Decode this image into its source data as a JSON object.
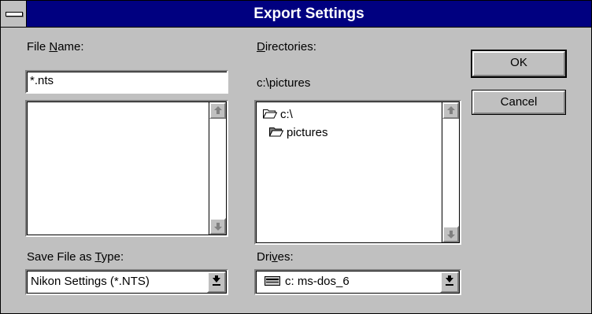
{
  "window": {
    "title": "Export Settings"
  },
  "file_name": {
    "label_pre": "File ",
    "label_accel": "N",
    "label_post": "ame:",
    "value": "*.nts",
    "files": []
  },
  "save_type": {
    "label_pre": "Save File as ",
    "label_accel": "T",
    "label_post": "ype:",
    "selected": "Nikon Settings (*.NTS)"
  },
  "directories": {
    "label_pre": "",
    "label_accel": "D",
    "label_post": "irectories:",
    "current_path": "c:\\pictures",
    "tree": [
      {
        "label": "c:\\",
        "icon": "open-folder-icon"
      },
      {
        "label": "pictures",
        "icon": "open-folder-icon"
      }
    ]
  },
  "drives": {
    "label_pre": "Dri",
    "label_accel": "v",
    "label_post": "es:",
    "selected": "c: ms-dos_6",
    "icon": "hard-drive-icon"
  },
  "buttons": {
    "ok": "OK",
    "cancel": "Cancel"
  }
}
